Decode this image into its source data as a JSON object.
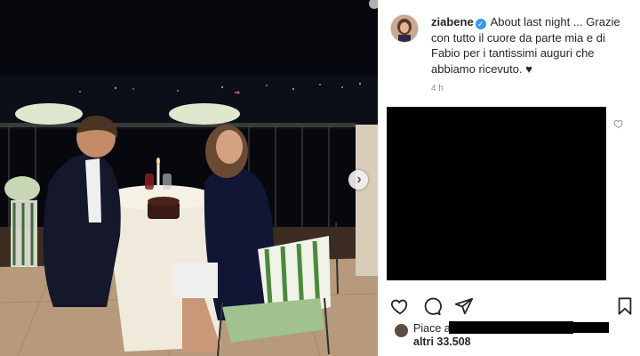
{
  "post": {
    "username": "ziabene",
    "caption": "About last night ... Grazie con tutto il cuore da parte mia e di Fabio per i tantissimi auguri che abbiamo ricevuto. ♥",
    "timestamp": "4 h"
  },
  "likes": {
    "prefix": "Piace a",
    "others": "altri 33.508"
  },
  "icons": {
    "verified": "verified-badge-icon",
    "like": "heart-icon",
    "comment": "comment-icon",
    "share": "paper-plane-icon",
    "save": "bookmark-icon",
    "next": "chevron-right-icon"
  },
  "colors": {
    "verified": "#3897f0",
    "text": "#262626",
    "secondary": "#8e8e8e"
  }
}
